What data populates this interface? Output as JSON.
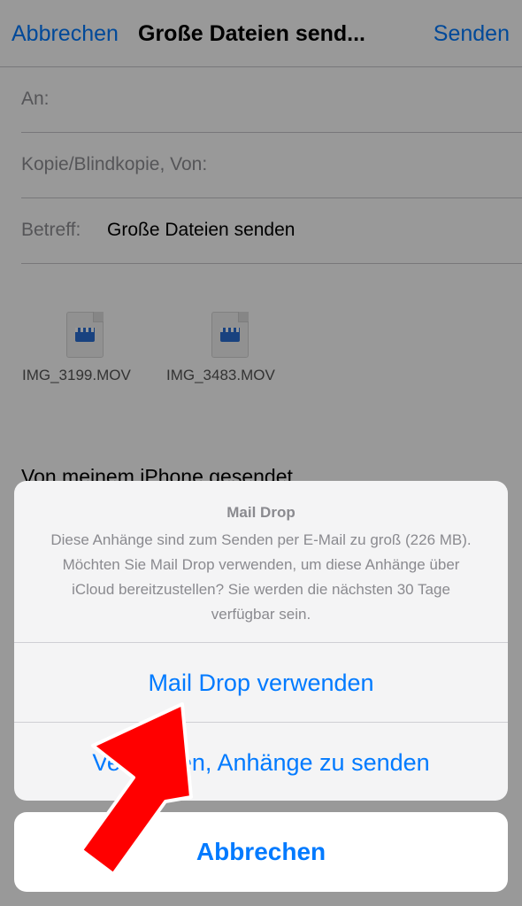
{
  "navbar": {
    "cancel_label": "Abbrechen",
    "title": "Große Dateien send...",
    "send_label": "Senden"
  },
  "fields": {
    "to_label": "An:",
    "cc_label": "Kopie/Blindkopie, Von:",
    "subject_label": "Betreff:",
    "subject_value": "Große Dateien senden"
  },
  "attachments": [
    {
      "name": "IMG_3199.MOV",
      "icon": "movie-file-icon"
    },
    {
      "name": "IMG_3483.MOV",
      "icon": "movie-file-icon"
    }
  ],
  "body": {
    "signature": "Von meinem iPhone gesendet"
  },
  "action_sheet": {
    "title": "Mail Drop",
    "message": "Diese Anhänge sind zum Senden per E-Mail zu groß (226 MB). Möchten Sie Mail Drop verwenden, um diese Anhänge über iCloud bereitzustellen? Sie werden die nächsten 30 Tage verfügbar sein.",
    "primary_action": "Mail Drop verwenden",
    "secondary_action": "Versuchen, Anhänge zu senden",
    "cancel_label": "Abbrechen"
  },
  "colors": {
    "accent": "#007aff",
    "annotation_arrow": "#ff0000"
  }
}
